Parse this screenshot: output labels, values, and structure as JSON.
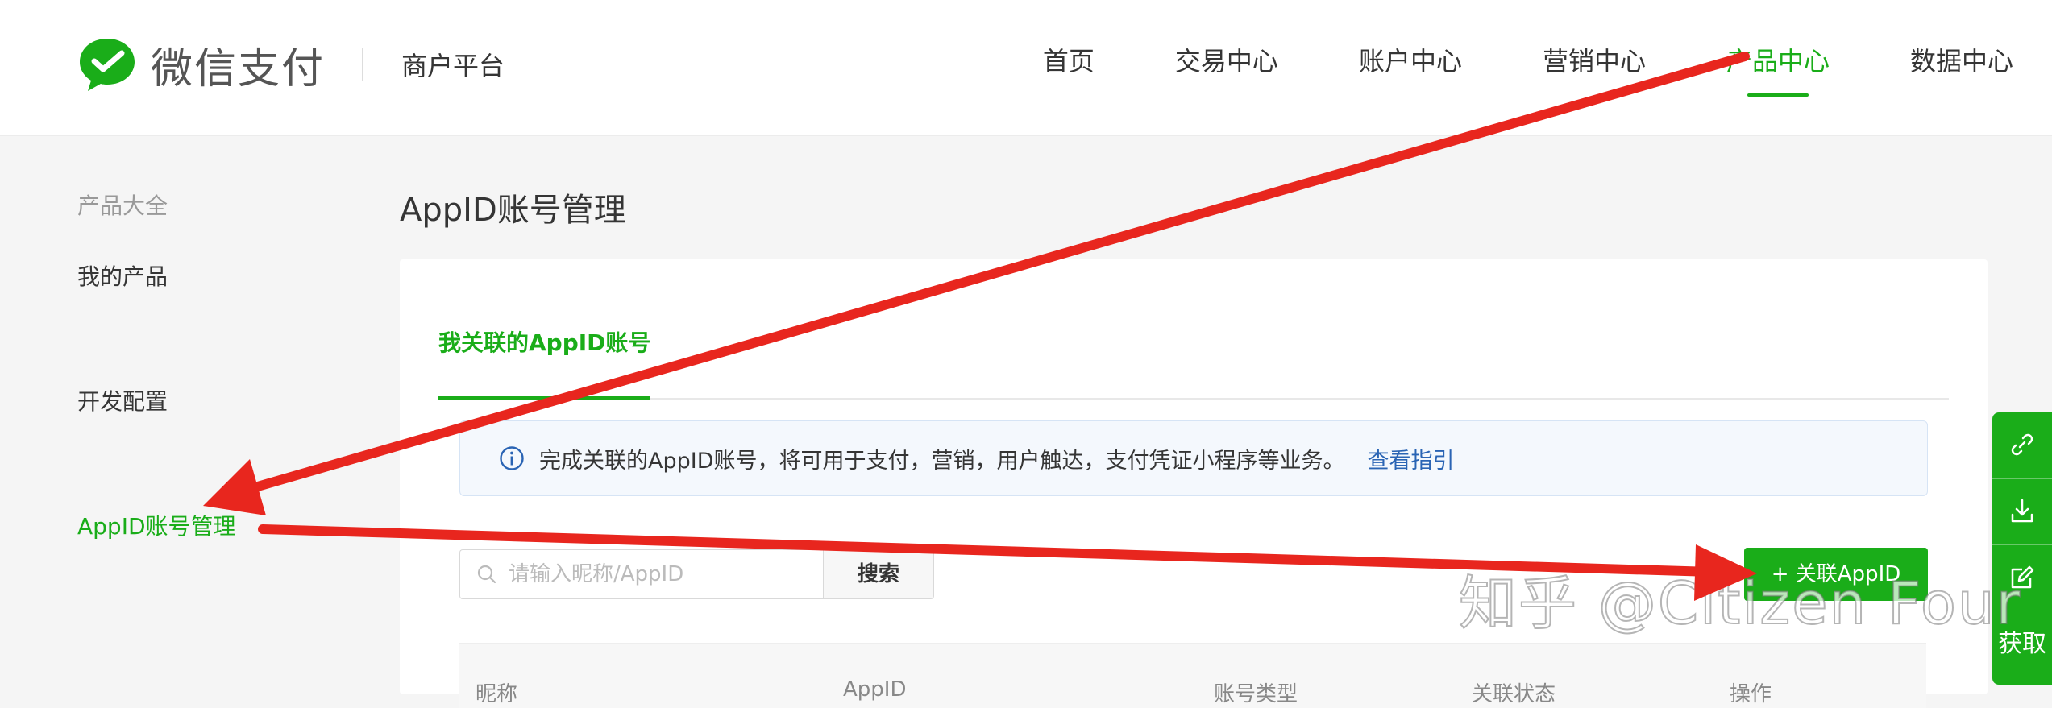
{
  "header": {
    "brand": "微信支付",
    "platform": "商户平台",
    "nav": [
      {
        "label": "首页",
        "active": false
      },
      {
        "label": "交易中心",
        "active": false
      },
      {
        "label": "账户中心",
        "active": false
      },
      {
        "label": "营销中心",
        "active": false
      },
      {
        "label": "产品中心",
        "active": true
      },
      {
        "label": "数据中心",
        "active": false
      }
    ]
  },
  "sidebar": {
    "heading": "产品大全",
    "items": [
      {
        "label": "我的产品"
      },
      {
        "label": "开发配置"
      },
      {
        "label": "AppID账号管理",
        "active": true
      }
    ]
  },
  "main": {
    "title": "AppID账号管理",
    "tab": "我关联的AppID账号",
    "notice": {
      "text": "完成关联的AppID账号，将可用于支付，营销，用户触达，支付凭证小程序等业务。",
      "link": "查看指引"
    },
    "search": {
      "placeholder": "请输入昵称/AppID",
      "button": "搜索"
    },
    "add_button": "+ 关联AppID",
    "table_headers": [
      "昵称",
      "AppID",
      "账号类型",
      "关联状态",
      "操作"
    ]
  },
  "toolbar": {
    "icons": [
      "link-icon",
      "download-icon",
      "edit-icon"
    ],
    "text": "获取"
  },
  "watermark": "知乎 @Citizen Four",
  "colors": {
    "brand_green": "#1aad19",
    "annotation_red": "#e8261e",
    "link_blue": "#2a64b4"
  }
}
